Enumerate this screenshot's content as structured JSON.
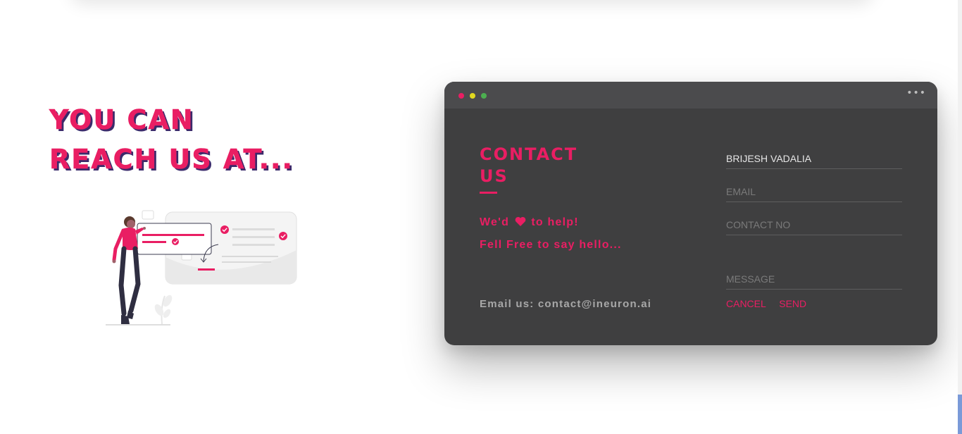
{
  "headline": {
    "line1": "YOU CAN",
    "line2": "REACH US AT..."
  },
  "card": {
    "title_line1": "CONTACT",
    "title_line2": "US",
    "help_before": "We'd",
    "help_after": "to help!",
    "hello": "Fell Free to say hello...",
    "email": "Email us: contact@ineuron.ai",
    "menu_icon": "•••"
  },
  "form": {
    "name_value": "BRIJESH VADALIA",
    "email_placeholder": "EMAIL",
    "phone_placeholder": "CONTACT NO",
    "message_placeholder": "MESSAGE",
    "cancel_label": "CANCEL",
    "send_label": "SEND"
  },
  "colors": {
    "accent": "#e91e63",
    "card_bg": "#3f3f40",
    "card_bar": "#4b4b4d",
    "dot_red": "#e91e63",
    "dot_yellow": "#e1d81f",
    "dot_green": "#4caf50"
  }
}
